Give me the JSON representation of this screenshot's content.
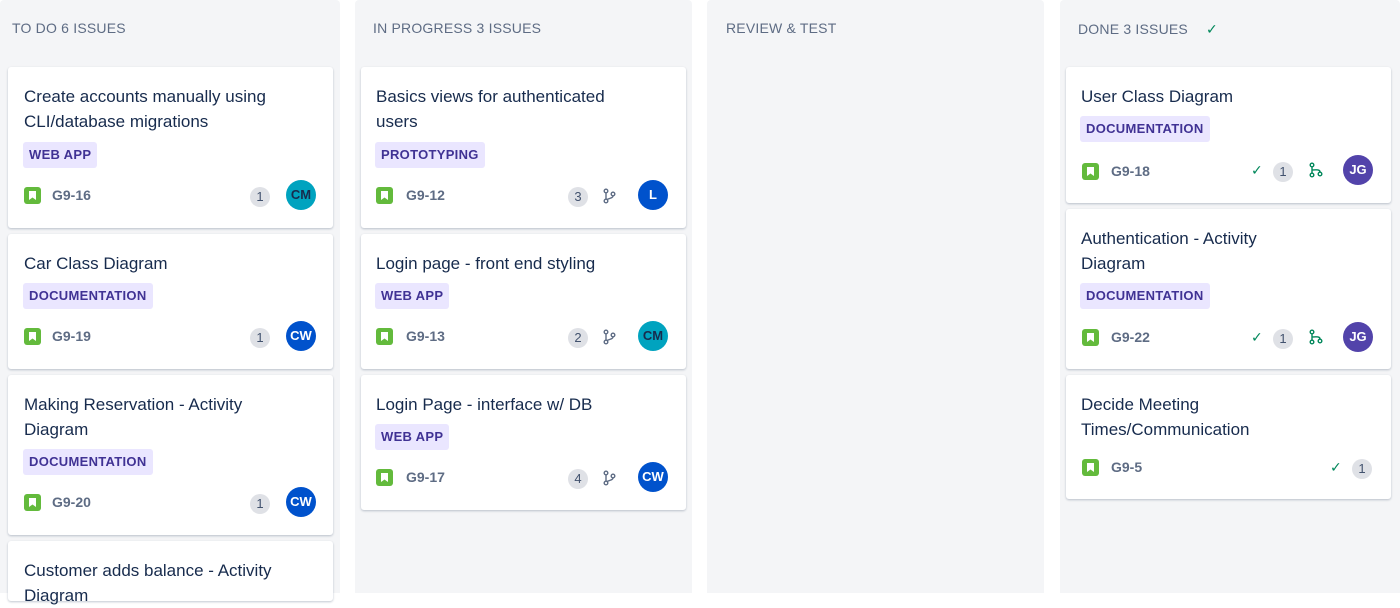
{
  "columns": [
    {
      "title": "TO DO 6 ISSUES"
    },
    {
      "title": "IN PROGRESS 3 ISSUES"
    },
    {
      "title": "REVIEW & TEST"
    },
    {
      "title": "DONE 3 ISSUES"
    }
  ],
  "colors": {
    "label_bg": "#eae6ff",
    "label_text": "#403294",
    "story": "#63ba3c",
    "done_check": "#00875a",
    "avatar_teal": "#00a3bf",
    "avatar_blue": "#0052cc",
    "avatar_purple": "#5243aa"
  },
  "todo": [
    {
      "title": "Create accounts manually using\nCLI/database migrations",
      "label": "WEB APP",
      "key": "G9-16",
      "count": "1",
      "avatar": "CM"
    },
    {
      "title": "Car Class Diagram",
      "label": "DOCUMENTATION",
      "key": "G9-19",
      "count": "1",
      "avatar": "CW"
    },
    {
      "title": "Making Reservation - Activity\nDiagram",
      "label": "DOCUMENTATION",
      "key": "G9-20",
      "count": "1",
      "avatar": "CW"
    },
    {
      "title": "Customer adds balance - Activity\nDiagram"
    }
  ],
  "inprogress": [
    {
      "title": "Basics views for authenticated\nusers",
      "label": "PROTOTYPING",
      "key": "G9-12",
      "count": "3",
      "avatar": "L"
    },
    {
      "title": "Login page - front end styling",
      "label": "WEB APP",
      "key": "G9-13",
      "count": "2",
      "avatar": "CM"
    },
    {
      "title": "Login Page - interface w/ DB",
      "label": "WEB APP",
      "key": "G9-17",
      "count": "4",
      "avatar": "CW"
    }
  ],
  "done": [
    {
      "title": "User Class Diagram",
      "label": "DOCUMENTATION",
      "key": "G9-18",
      "count": "1",
      "avatar": "JG"
    },
    {
      "title": "Authentication - Activity\nDiagram",
      "label": "DOCUMENTATION",
      "key": "G9-22",
      "count": "1",
      "avatar": "JG"
    },
    {
      "title": "Decide Meeting\nTimes/Communication",
      "key": "G9-5",
      "count": "1"
    }
  ],
  "icons": {
    "story": "story-bookmark-icon",
    "branch": "branch-icon",
    "pr": "pull-request-icon",
    "check": "check-icon"
  }
}
